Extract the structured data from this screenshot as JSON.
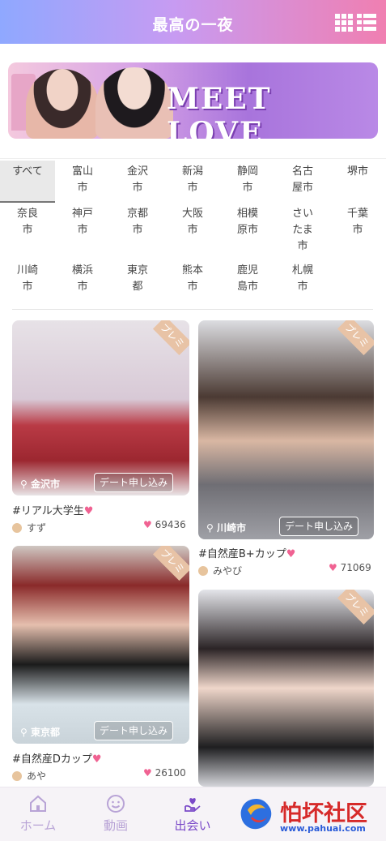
{
  "header": {
    "title": "最高の一夜"
  },
  "banner": {
    "text": "MEET LOVE"
  },
  "cities": [
    "すべて",
    "富山市",
    "金沢市",
    "新潟市",
    "静岡市",
    "名古屋市",
    "堺市",
    "奈良市",
    "神戸市",
    "京都市",
    "大阪市",
    "相模原市",
    "さいたま市",
    "千葉市",
    "川崎市",
    "横浜市",
    "東京都",
    "熊本市",
    "鹿児島市",
    "札幌市"
  ],
  "cards": [
    {
      "badge": "プレミ",
      "location": "金沢市",
      "button": "デート申し込み",
      "tag": "#リアル大学生",
      "user": "すず",
      "likes": "69436"
    },
    {
      "badge": "プレミ",
      "location": "川崎市",
      "button": "デート申し込み",
      "tag": "#自然産B+カップ",
      "user": "みやび",
      "likes": "71069"
    },
    {
      "badge": "プレミ",
      "location": "東京都",
      "button": "デート申し込み",
      "tag": "#自然産Dカップ",
      "user": "あや",
      "likes": "26100"
    },
    {
      "badge": "プレミ"
    }
  ],
  "tabs": {
    "home": "ホーム",
    "video": "動画",
    "meet": "出会い"
  },
  "watermark": {
    "main": "怕坏社区",
    "url": "www.pahuai.com"
  },
  "colors": {
    "accent": "#7a49c8",
    "heart": "#f06292",
    "header_start": "#8fa8ff",
    "header_end": "#f07fb1"
  }
}
